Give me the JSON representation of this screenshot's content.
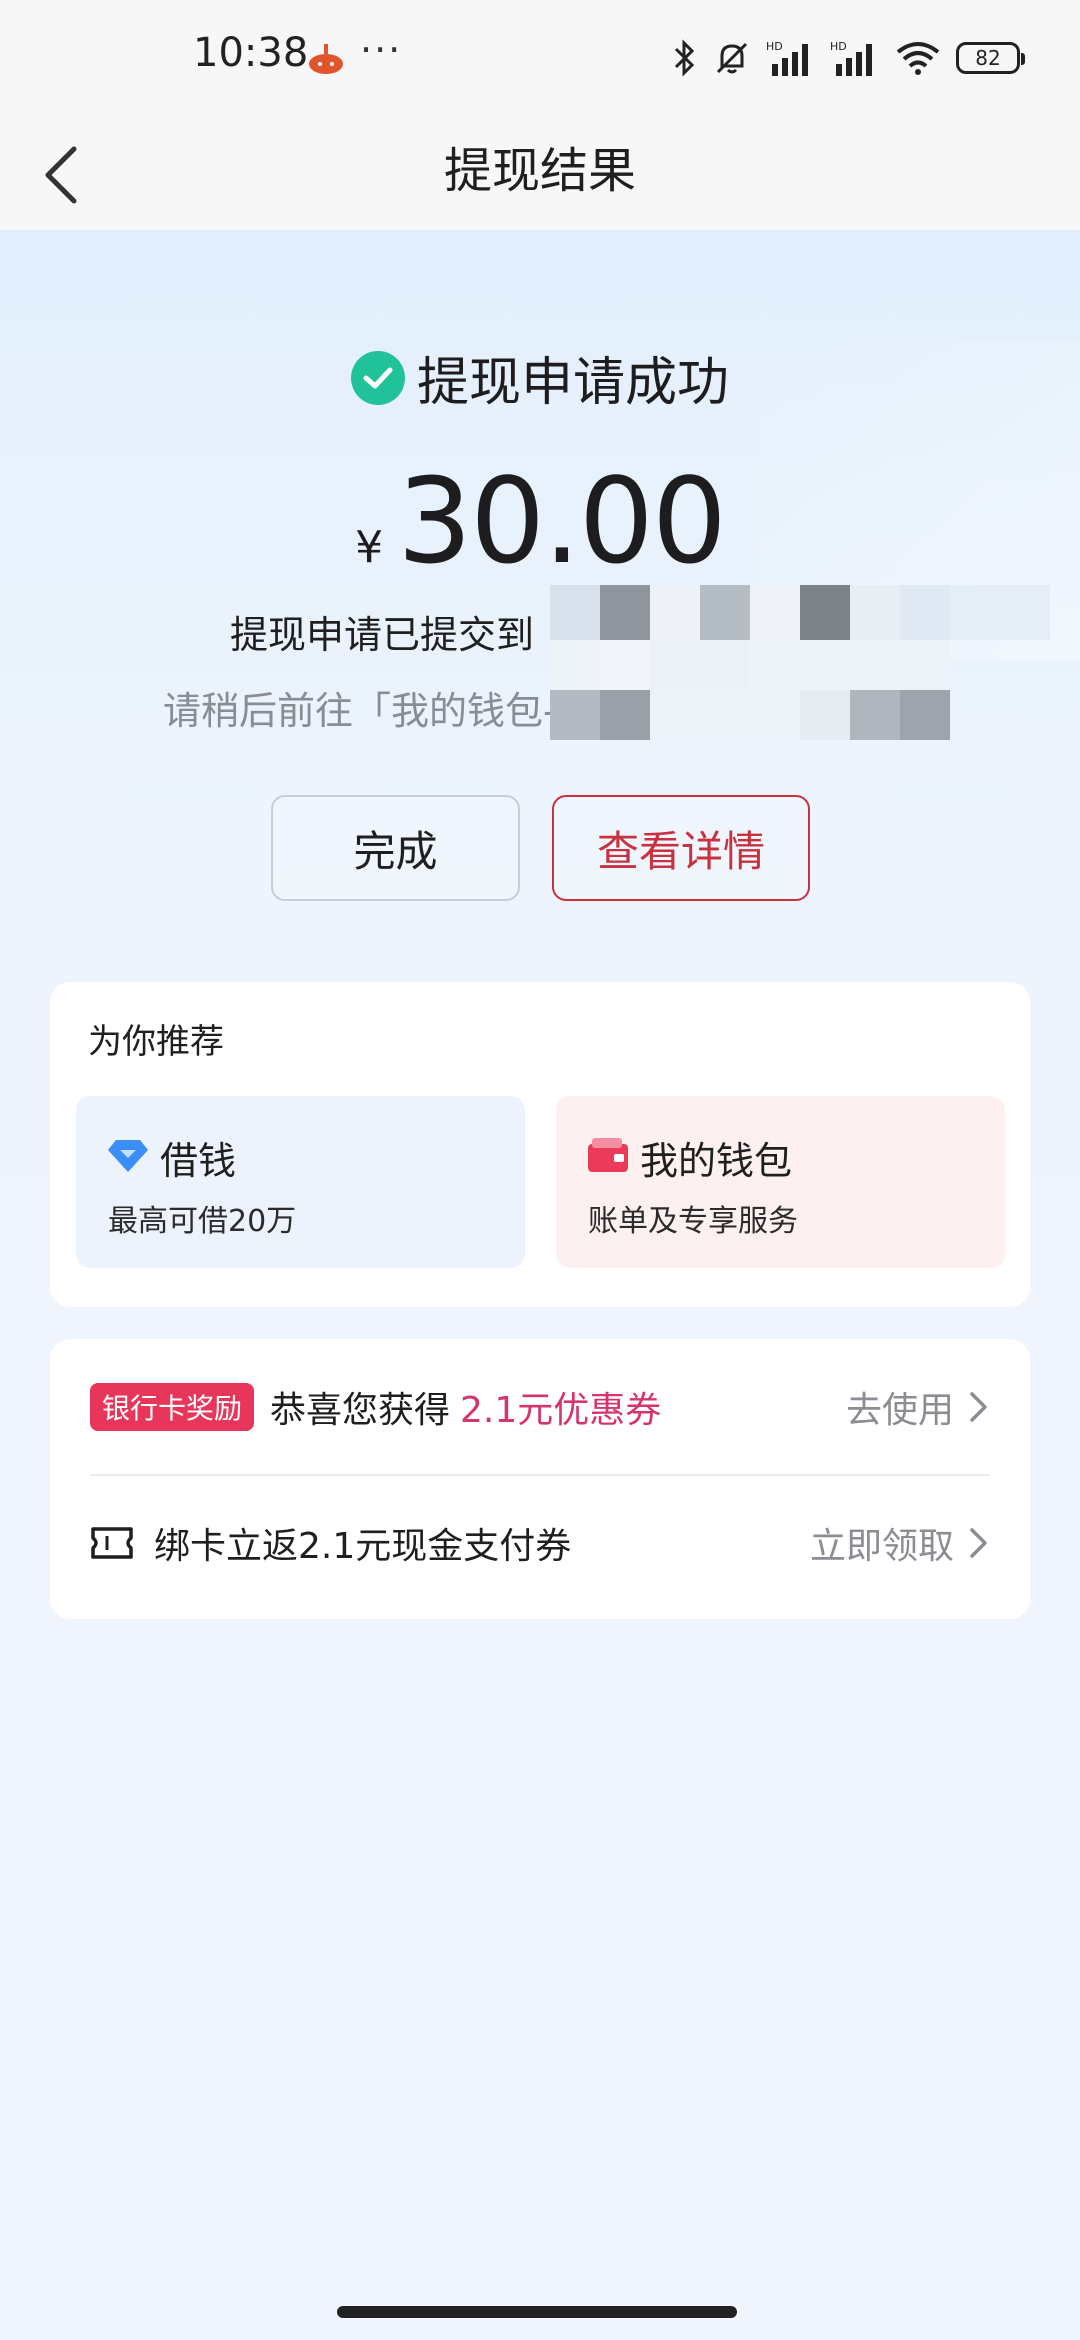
{
  "status_bar": {
    "time": "10:38",
    "more": "···",
    "battery": "82"
  },
  "nav": {
    "title": "提现结果"
  },
  "result": {
    "status_text": "提现申请成功",
    "currency": "¥",
    "amount": "30.00",
    "submitted_text": "提现申请已提交到",
    "hint_text": "请稍后前往「我的钱包-"
  },
  "actions": {
    "done_label": "完成",
    "detail_label": "查看详情"
  },
  "recommend": {
    "title": "为你推荐",
    "items": [
      {
        "title": "借钱",
        "subtitle": "最高可借20万"
      },
      {
        "title": "我的钱包",
        "subtitle": "账单及专享服务"
      }
    ]
  },
  "rewards": {
    "badge": "银行卡奖励",
    "row1_text": "恭喜您获得",
    "row1_highlight": "2.1元优惠券",
    "row1_action": "去使用",
    "row2_text": "绑卡立返2.1元现金支付券",
    "row2_action": "立即领取"
  },
  "colors": {
    "accent_red": "#c8313e",
    "success_green": "#21c29a",
    "badge_pink": "#e8365a",
    "highlight_pink": "#d6356a"
  }
}
